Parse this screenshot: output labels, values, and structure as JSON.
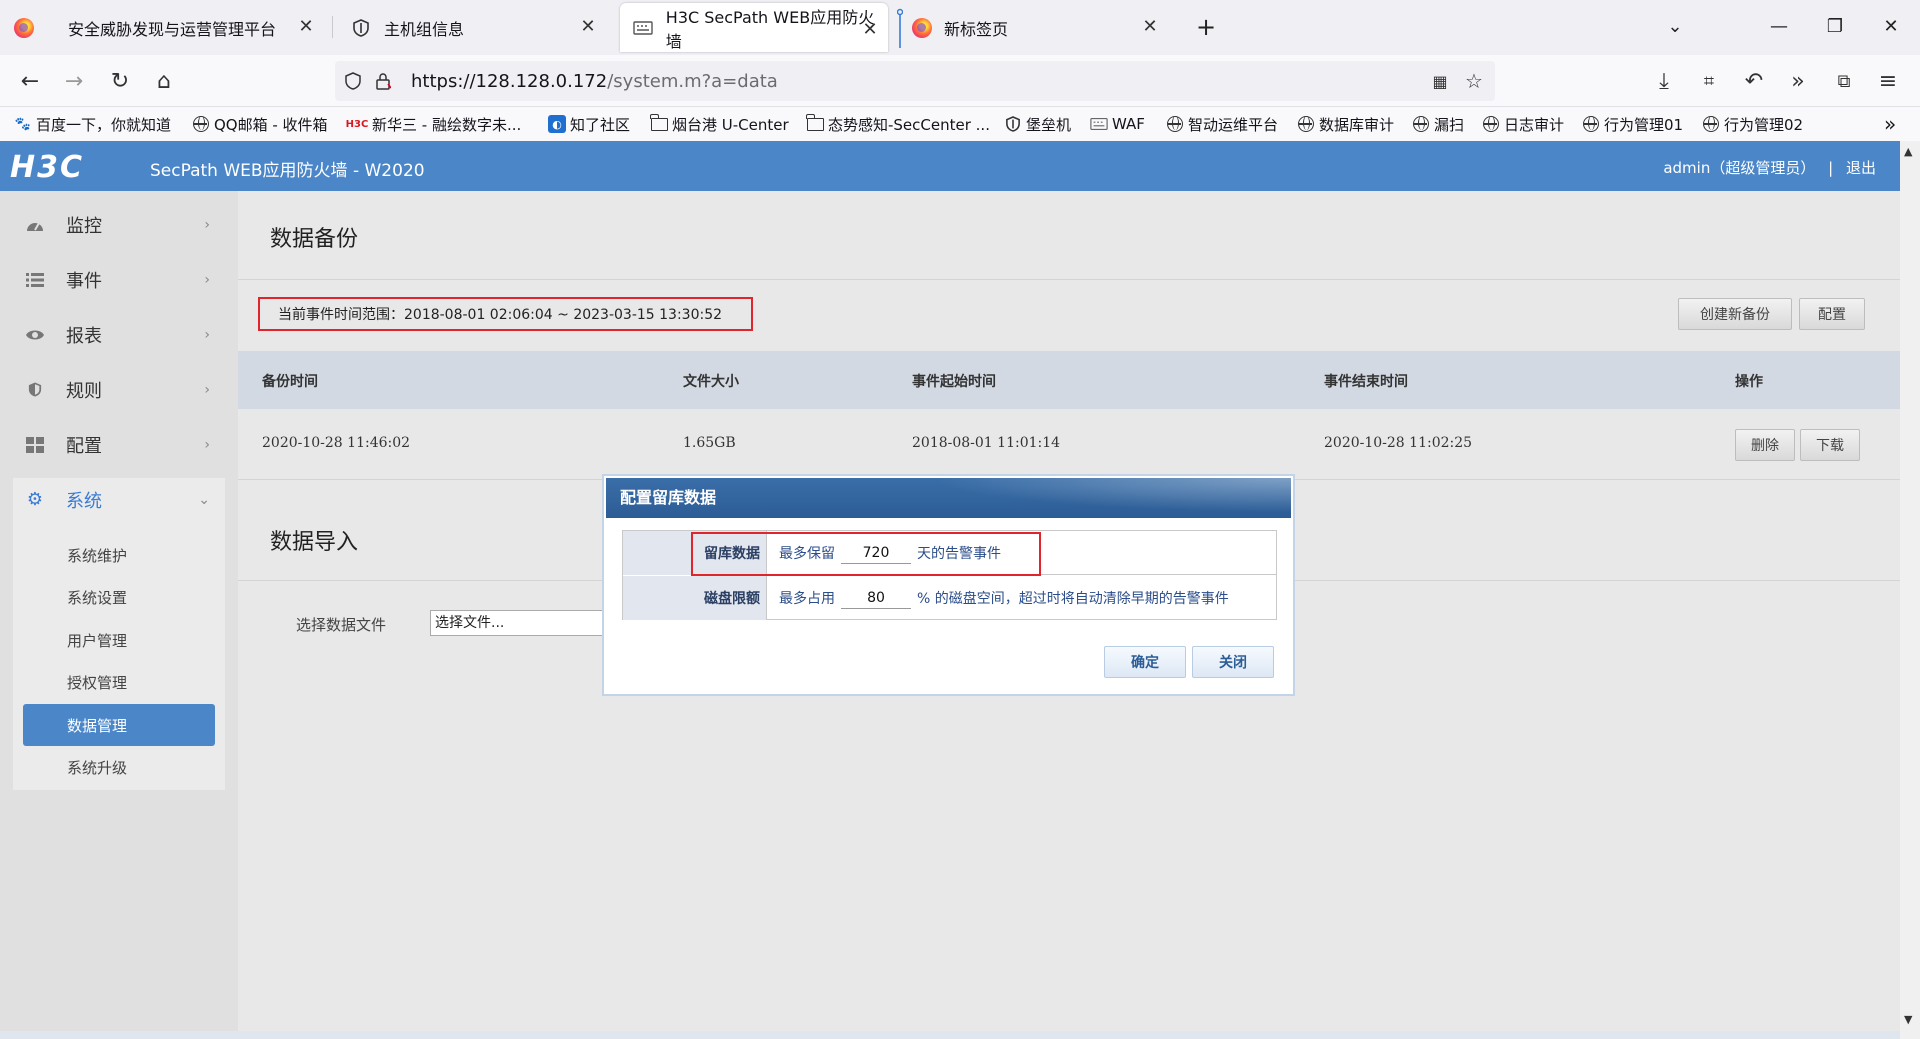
{
  "browser": {
    "tabs": [
      {
        "label": "安全威胁发现与运营管理平台"
      },
      {
        "label": "主机组信息"
      },
      {
        "label": "H3C SecPath WEB应用防火墙"
      },
      {
        "label": "新标签页"
      }
    ],
    "url_host": "https://128.128.0.172",
    "url_path": "/system.m?a=data",
    "bookmarks": [
      {
        "label": "百度一下，你就知道",
        "icon": "baidu-icon"
      },
      {
        "label": "QQ邮箱 - 收件箱",
        "icon": "globe-icon"
      },
      {
        "label": "新华三 - 融绘数字未...",
        "icon": "h3c-icon"
      },
      {
        "label": "知了社区",
        "icon": "zhiliao-icon"
      },
      {
        "label": "烟台港 U-Center",
        "icon": "folder-icon"
      },
      {
        "label": "态势感知-SecCenter ...",
        "icon": "folder-icon"
      },
      {
        "label": "堡垒机",
        "icon": "shield-icon"
      },
      {
        "label": "WAF",
        "icon": "waf-icon"
      },
      {
        "label": "智动运维平台",
        "icon": "globe-icon"
      },
      {
        "label": "数据库审计",
        "icon": "globe-icon"
      },
      {
        "label": "漏扫",
        "icon": "globe-icon"
      },
      {
        "label": "日志审计",
        "icon": "globe-icon"
      },
      {
        "label": "行为管理01",
        "icon": "globe-icon"
      },
      {
        "label": "行为管理02",
        "icon": "globe-icon"
      }
    ]
  },
  "app": {
    "logo": "H3C",
    "title": "SecPath WEB应用防火墙 - W2020",
    "user": "admin（超级管理员）",
    "separator": "|",
    "logout": "退出",
    "accent_color": "#4a86c8"
  },
  "sidebar": {
    "items": [
      {
        "label": "监控",
        "icon": "dashboard-icon"
      },
      {
        "label": "事件",
        "icon": "list-icon"
      },
      {
        "label": "报表",
        "icon": "eye-icon"
      },
      {
        "label": "规则",
        "icon": "shield-icon"
      },
      {
        "label": "配置",
        "icon": "grid-icon"
      },
      {
        "label": "系统",
        "icon": "gear-icon"
      }
    ],
    "submenu": [
      {
        "label": "系统维护"
      },
      {
        "label": "系统设置"
      },
      {
        "label": "用户管理"
      },
      {
        "label": "授权管理"
      },
      {
        "label": "数据管理"
      },
      {
        "label": "系统升级"
      }
    ]
  },
  "main": {
    "backup_title": "数据备份",
    "range_text": "当前事件时间范围：2018-08-01 02:06:04 ~ 2023-03-15 13:30:52",
    "create_backup": "创建新备份",
    "config": "配置",
    "columns": [
      "备份时间",
      "文件大小",
      "事件起始时间",
      "事件结束时间",
      "操作"
    ],
    "rows": [
      {
        "backup_time": "2020-10-28 11:46:02",
        "size": "1.65GB",
        "start": "2018-08-01 11:01:14",
        "end": "2020-10-28 11:02:25",
        "delete": "删除",
        "download": "下载"
      }
    ],
    "import_title": "数据导入",
    "file_label": "选择数据文件",
    "file_button": "选择文件..."
  },
  "dialog": {
    "title": "配置留库数据",
    "retain_label": "留库数据",
    "retain_prefix": "最多保留",
    "retain_value": "720",
    "retain_suffix": "天的告警事件",
    "disk_label": "磁盘限额",
    "disk_prefix": "最多占用",
    "disk_value": "80",
    "disk_suffix": "% 的磁盘空间，超过时将自动清除早期的告警事件",
    "ok": "确定",
    "close": "关闭"
  }
}
